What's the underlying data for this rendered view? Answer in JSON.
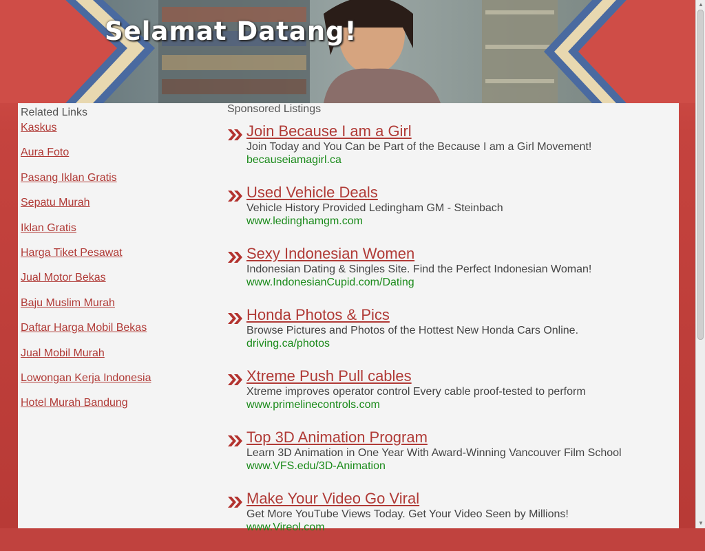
{
  "header": {
    "title": "Selamat Datang!"
  },
  "related": {
    "title": "Related Links",
    "links": [
      "Kaskus",
      "Aura Foto",
      "Pasang Iklan Gratis",
      "Sepatu Murah",
      "Iklan Gratis",
      "Harga Tiket Pesawat",
      "Jual Motor Bekas",
      "Baju Muslim Murah",
      "Daftar Harga Mobil Bekas",
      "Jual Mobil Murah",
      "Lowongan Kerja Indonesia",
      "Hotel Murah Bandung"
    ]
  },
  "sponsored": {
    "title": "Sponsored Listings",
    "listings": [
      {
        "title": "Join Because I am a Girl",
        "desc": "Join Today and You Can be Part of the Because I am a Girl Movement!",
        "url": "becauseiamagirl.ca"
      },
      {
        "title": "Used Vehicle Deals",
        "desc": "Vehicle History Provided Ledingham GM - Steinbach",
        "url": "www.ledinghamgm.com"
      },
      {
        "title": "Sexy Indonesian Women",
        "desc": "Indonesian Dating & Singles Site. Find the Perfect Indonesian Woman!",
        "url": "www.IndonesianCupid.com/Dating"
      },
      {
        "title": "Honda Photos & Pics",
        "desc": "Browse Pictures and Photos of the Hottest New Honda Cars Online.",
        "url": "driving.ca/photos"
      },
      {
        "title": "Xtreme Push Pull cables",
        "desc": "Xtreme improves operator control Every cable proof-tested to perform",
        "url": "www.primelinecontrols.com"
      },
      {
        "title": "Top 3D Animation Program",
        "desc": "Learn 3D Animation in One Year With Award-Winning Vancouver Film School",
        "url": "www.VFS.edu/3D-Animation"
      },
      {
        "title": "Make Your Video Go Viral",
        "desc": "Get More YouTube Views Today. Get Your Video Seen by Millions!",
        "url": "www.Vireol.com"
      }
    ]
  },
  "colors": {
    "accent": "#b03a36",
    "url_green": "#1a8a1a",
    "page_red": "#c0423e"
  },
  "icons": {
    "listing_bullet": "double-chevron-arrow-icon"
  }
}
